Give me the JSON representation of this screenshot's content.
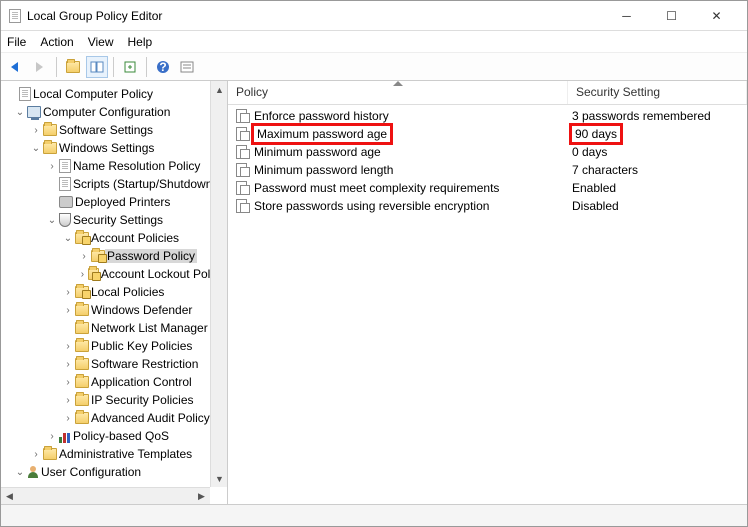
{
  "window": {
    "title": "Local Group Policy Editor"
  },
  "menu": {
    "file": "File",
    "action": "Action",
    "view": "View",
    "help": "Help"
  },
  "tree": {
    "root": "Local Computer Policy",
    "cc": "Computer Configuration",
    "ss": "Software Settings",
    "ws": "Windows Settings",
    "nrp": "Name Resolution Policy",
    "scr": "Scripts (Startup/Shutdown)",
    "dp": "Deployed Printers",
    "secset": "Security Settings",
    "ap": "Account Policies",
    "pp": "Password Policy",
    "al": "Account Lockout Policy",
    "lp": "Local Policies",
    "wd": "Windows Defender",
    "nlm": "Network List Manager",
    "pkp": "Public Key Policies",
    "srp": "Software Restriction",
    "acp": "Application Control",
    "ips": "IP Security Policies",
    "aap": "Advanced Audit Policy",
    "pbq": "Policy-based QoS",
    "at": "Administrative Templates",
    "uc": "User Configuration"
  },
  "list": {
    "col1": "Policy",
    "col2": "Security Setting",
    "rows": [
      {
        "name": "Enforce password history",
        "val": "3 passwords remembered",
        "hi": false
      },
      {
        "name": "Maximum password age",
        "val": "90 days",
        "hi": true
      },
      {
        "name": "Minimum password age",
        "val": "0 days",
        "hi": false
      },
      {
        "name": "Minimum password length",
        "val": "7 characters",
        "hi": false
      },
      {
        "name": "Password must meet complexity requirements",
        "val": "Enabled",
        "hi": false
      },
      {
        "name": "Store passwords using reversible encryption",
        "val": "Disabled",
        "hi": false
      }
    ]
  }
}
